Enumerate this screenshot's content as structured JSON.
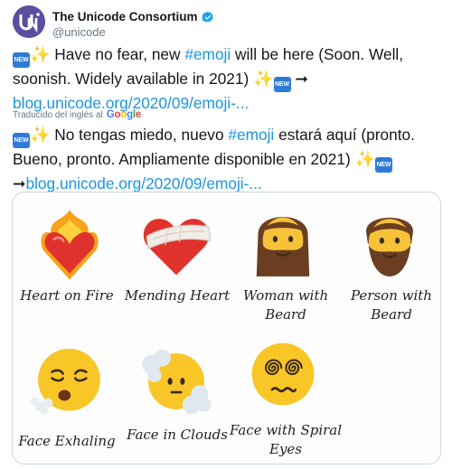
{
  "account": {
    "display_name": "The Unicode Consortium",
    "handle": "@unicode",
    "avatar_icon": "unicode-logo-icon",
    "verified_icon": "verified-badge-icon"
  },
  "tweet": {
    "new_badge": "NEW",
    "sparkle": "✨",
    "part1": " Have no fear, new ",
    "hashtag": "#emoji",
    "part2": " will be here (Soon. Well, soonish. Widely available in 2021) ",
    "arrow": " ➞",
    "link": "blog.unicode.org/2020/09/emoji-..."
  },
  "translation": {
    "label": "Traducido del inglés al",
    "google_G": "G",
    "google_o1": "o",
    "google_o2": "o",
    "google_g": "g",
    "google_l": "l",
    "google_e": "e",
    "part1": " No tengas miedo, nuevo ",
    "hashtag": "#emoji",
    "part2": " estará aquí (pronto. Bueno, pronto. Ampliamente disponible en 2021) ",
    "arrow": "➞",
    "link": "blog.unicode.org/2020/09/emoji-..."
  },
  "card": {
    "emojis": [
      {
        "label": "Heart on Fire",
        "icon": "heart-on-fire-icon"
      },
      {
        "label": "Mending Heart",
        "icon": "mending-heart-icon"
      },
      {
        "label": "Woman with Beard",
        "icon": "woman-with-beard-icon"
      },
      {
        "label": "Person with Beard",
        "icon": "person-with-beard-icon"
      },
      {
        "label": "Face Exhaling",
        "icon": "face-exhaling-icon"
      },
      {
        "label": "Face in Clouds",
        "icon": "face-in-clouds-icon"
      },
      {
        "label": "Face with Spiral Eyes",
        "icon": "face-with-spiral-eyes-icon"
      }
    ]
  },
  "colors": {
    "link": "#1b95e0",
    "avatar": "#5b4ea0",
    "new_badge": "#2f7ad6",
    "emoji_yellow": "#f9c628",
    "heart_red": "#e0322c"
  }
}
